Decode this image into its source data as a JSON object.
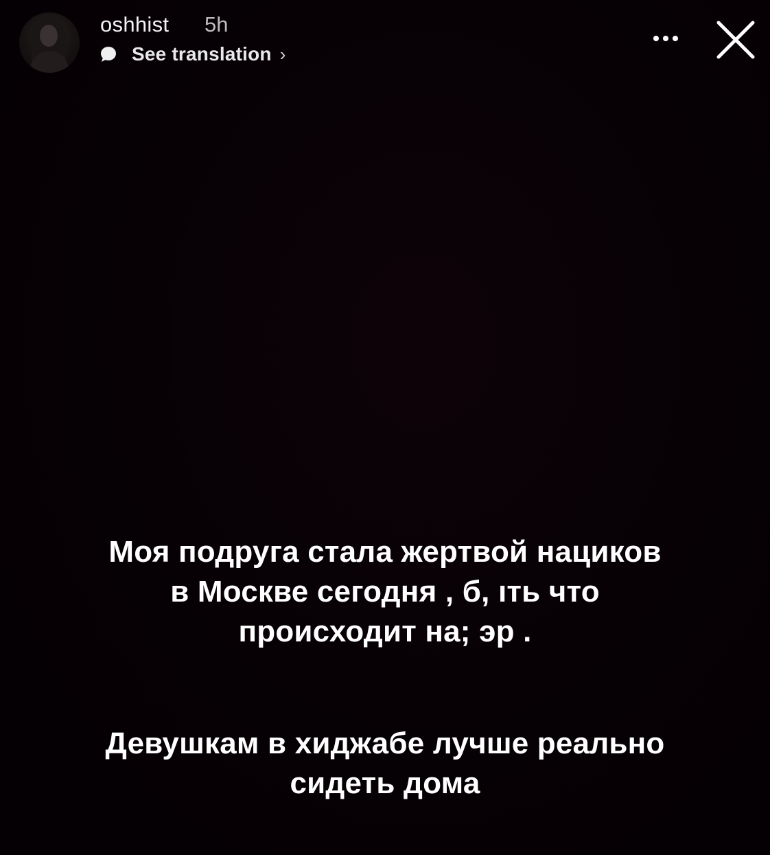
{
  "header": {
    "username": "oshhist",
    "time": "5h",
    "translation_label": "See translation",
    "chevron": "›",
    "icons": {
      "avatar": "profile-avatar",
      "translation": "speech-bubble-icon",
      "more": "more-dots-icon",
      "close": "close-icon"
    }
  },
  "story": {
    "paragraph1": [
      "Моя подруга стала жертвой нациков",
      "в Москве сегодня , б, ıть что",
      "происходит на;  эр ."
    ],
    "paragraph2": [
      "Девушкам в хиджабе лучше реально",
      "сидеть дома"
    ]
  },
  "colors": {
    "background": "#050004",
    "text": "#ffffff",
    "secondary_text": "#bdbdbd"
  }
}
